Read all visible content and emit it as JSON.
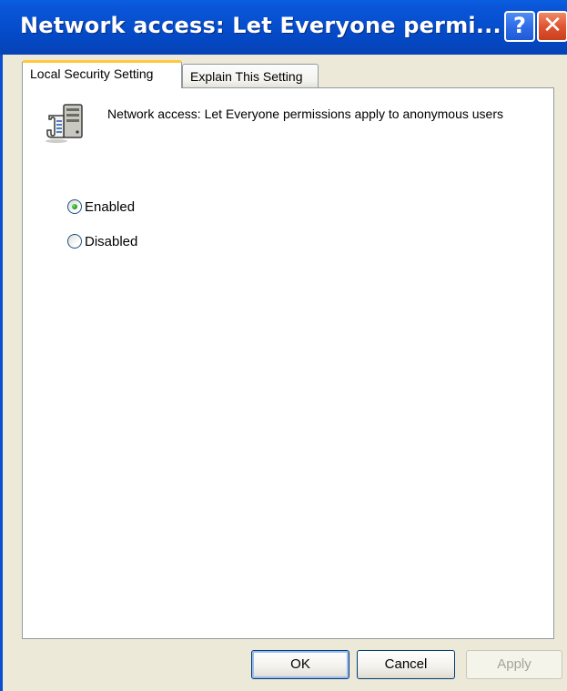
{
  "window": {
    "title": "Network access: Let Everyone permi...",
    "help_label": "?",
    "close_label": "✕"
  },
  "tabs": [
    {
      "label": "Local Security Setting",
      "active": true
    },
    {
      "label": "Explain This Setting",
      "active": false
    }
  ],
  "policy": {
    "icon": "policy-scroll-computer-icon",
    "description": "Network access: Let Everyone permissions apply to anonymous users"
  },
  "options": [
    {
      "label": "Enabled",
      "checked": true
    },
    {
      "label": "Disabled",
      "checked": false
    }
  ],
  "buttons": {
    "ok": "OK",
    "cancel": "Cancel",
    "apply": "Apply",
    "apply_enabled": false
  },
  "colors": {
    "titlebar": "#0650d0",
    "tab_highlight": "#ffc83c",
    "radio_dot": "#21a121",
    "close_button": "#e05533"
  }
}
